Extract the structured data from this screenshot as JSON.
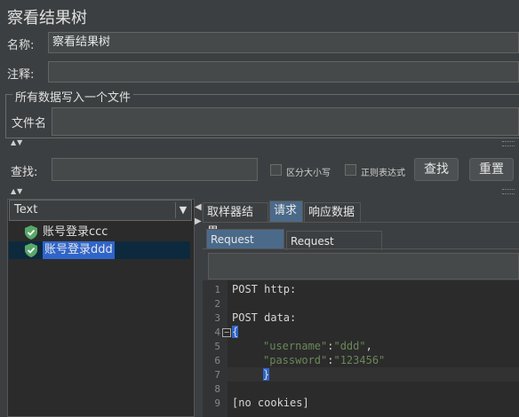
{
  "window": {
    "title": "察看结果树"
  },
  "name_field": {
    "label": "名称:",
    "value": "察看结果树"
  },
  "comment_field": {
    "label": "注释:",
    "value": ""
  },
  "file_group": {
    "legend": "所有数据写入一个文件",
    "filename_label": "文件名",
    "filename_value": ""
  },
  "search": {
    "label": "查找:",
    "value": "",
    "case_sensitive_label": "区分大小写",
    "regex_label": "正则表达式",
    "find_button": "查找",
    "reset_button": "重置"
  },
  "renderer": {
    "selected": "Text"
  },
  "tree": {
    "items": [
      {
        "label": "账号登录ccc",
        "status": "success"
      },
      {
        "label": "账号登录ddd",
        "status": "success",
        "selected": true
      }
    ]
  },
  "result_tabs": [
    {
      "label": "取样器结果"
    },
    {
      "label": "请求",
      "active": true
    },
    {
      "label": "响应数据"
    }
  ],
  "request_tabs": [
    {
      "label": "Request Body",
      "active": true
    },
    {
      "label": "Request Headers"
    }
  ],
  "code": {
    "line_numbers": [
      "1",
      "2",
      "3",
      "4",
      "5",
      "6",
      "7",
      "8",
      "9"
    ],
    "line1": "POST http:",
    "line3": "POST data:",
    "line4": "{",
    "line5_key": "\"username\"",
    "line5_sep": ":",
    "line5_val": "\"ddd\"",
    "line5_end": ",",
    "line6_key": "\"password\"",
    "line6_sep": ":",
    "line6_val": "\"123456\"",
    "line7": "}",
    "line9": "[no cookies]"
  },
  "colors": {
    "background": "#3c3f41",
    "editor": "#2b2b2b",
    "selection": "#0d293e",
    "active_tab": "#4b6a8a",
    "string": "#6a8759",
    "success": "#59a869"
  },
  "icons": [
    "shield-check-icon",
    "dropdown-arrow-icon",
    "collapse-arrows-icon",
    "fold-icon"
  ]
}
